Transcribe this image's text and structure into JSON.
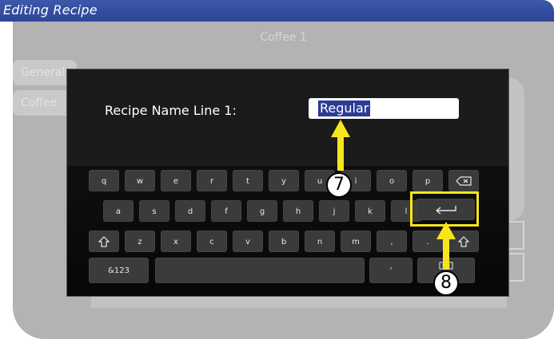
{
  "window": {
    "title": "Editing Recipe"
  },
  "screen": {
    "title": "Coffee 1",
    "side_tabs": [
      "General",
      "Coffee"
    ]
  },
  "dialog": {
    "label": "Recipe Name Line 1:",
    "field_value": "Regular"
  },
  "keyboard": {
    "row1": [
      "q",
      "w",
      "e",
      "r",
      "t",
      "y",
      "u",
      "i",
      "o",
      "p"
    ],
    "row2": [
      "a",
      "s",
      "d",
      "f",
      "g",
      "h",
      "j",
      "k",
      "l"
    ],
    "row3": [
      "z",
      "x",
      "c",
      "v",
      "b",
      "n",
      "m",
      ",",
      "."
    ],
    "mode_key": "&123",
    "apostrophe_key": "'"
  },
  "callouts": {
    "step7": "7",
    "step8": "8"
  },
  "colors": {
    "titlebar": "#2c4597",
    "highlight": "#f7e61c",
    "selection": "#2b3b96"
  }
}
